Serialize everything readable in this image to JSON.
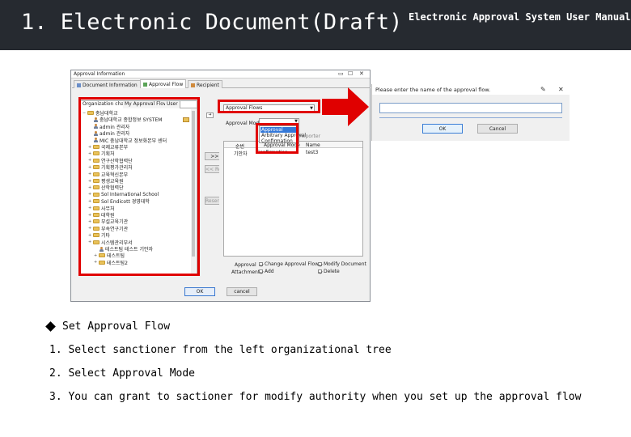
{
  "header": {
    "title": "1. Electronic Document(Draft)",
    "manual": "Electronic Approval System User Manual"
  },
  "window": {
    "title": "Approval Information",
    "tabs": [
      {
        "label": "Document Information"
      },
      {
        "label": "Approval Flow"
      },
      {
        "label": "Recipient"
      }
    ],
    "org_tabs": [
      {
        "label": "Organization chart"
      },
      {
        "label": "My Approval Flow"
      },
      {
        "label": "User"
      }
    ],
    "tree": [
      {
        "label": "충남대학교",
        "type": "folder",
        "level": 0
      },
      {
        "label": "충남대학교 종합정보 SYSTEM",
        "type": "person",
        "level": 1
      },
      {
        "label": "admin 관리자",
        "type": "person",
        "level": 1
      },
      {
        "label": "admin 관리자",
        "type": "person",
        "level": 1
      },
      {
        "label": "MIC 충남대학교 정보화본부 센터",
        "type": "person",
        "level": 1
      },
      {
        "label": "국제교류본부",
        "type": "folder",
        "level": 1
      },
      {
        "label": "기획처",
        "type": "folder",
        "level": 1
      },
      {
        "label": "연구산학협력단",
        "type": "folder",
        "level": 1
      },
      {
        "label": "기획평가관리처",
        "type": "folder",
        "level": 1
      },
      {
        "label": "교육혁신본부",
        "type": "folder",
        "level": 1
      },
      {
        "label": "평생교육원",
        "type": "folder",
        "level": 1
      },
      {
        "label": "산학협력단",
        "type": "folder",
        "level": 1
      },
      {
        "label": "Sol International School",
        "type": "folder",
        "level": 1
      },
      {
        "label": "Sol Endicott 경영대학",
        "type": "folder",
        "level": 1
      },
      {
        "label": "사무처",
        "type": "folder",
        "level": 1
      },
      {
        "label": "대학원",
        "type": "folder",
        "level": 1
      },
      {
        "label": "부설교육기관",
        "type": "folder",
        "level": 1
      },
      {
        "label": "부속연구기관",
        "type": "folder",
        "level": 1
      },
      {
        "label": "기타",
        "type": "folder",
        "level": 1
      },
      {
        "label": "시스템관리부서",
        "type": "folder",
        "level": 1
      },
      {
        "label": "테스트팀 테스트 기안자",
        "type": "person",
        "level": 2
      },
      {
        "label": "테스트팀",
        "type": "folder",
        "level": 2
      },
      {
        "label": "테스트팀2",
        "type": "folder",
        "level": 2
      }
    ],
    "buttons": {
      "add": ">> Add",
      "remove": "<< Remove",
      "reserve": "Reserve Info",
      "ok": "OK",
      "cancel": "cancel"
    },
    "flow_select": "Approval Flows",
    "mode_label": "Approval Mode",
    "mode_options": [
      {
        "label": "Approval"
      },
      {
        "label": "Arbitrary Approval"
      },
      {
        "label": "Confirmation"
      }
    ],
    "mode_extra": "Reporter",
    "line_table": {
      "headers": [
        "순번",
        "Approval Mode",
        "Name"
      ],
      "rows": [
        {
          "order": "기안자",
          "mode": "Confirmation",
          "name": "test3"
        }
      ]
    },
    "approval_label": "Approval",
    "attachments_label": "Attachments",
    "checks": {
      "change_flow": "Change Approval Flow",
      "modify_doc": "Modify Document",
      "add": "Add",
      "delete": "Delete"
    }
  },
  "dialog": {
    "title": "Please enter the name of the approval flow.",
    "input_value": "",
    "ok": "OK",
    "cancel": "Cancel"
  },
  "instructions": {
    "heading": "Set Approval Flow",
    "steps": [
      "1. Select sanctioner from the left organizational tree",
      "2. Select Approval Mode",
      "3. You can grant to sactioner for modify authority when you set up the approval flow"
    ]
  },
  "colors": {
    "header_bg": "#262a30",
    "highlight": "#e00000",
    "selection": "#3478d8"
  }
}
